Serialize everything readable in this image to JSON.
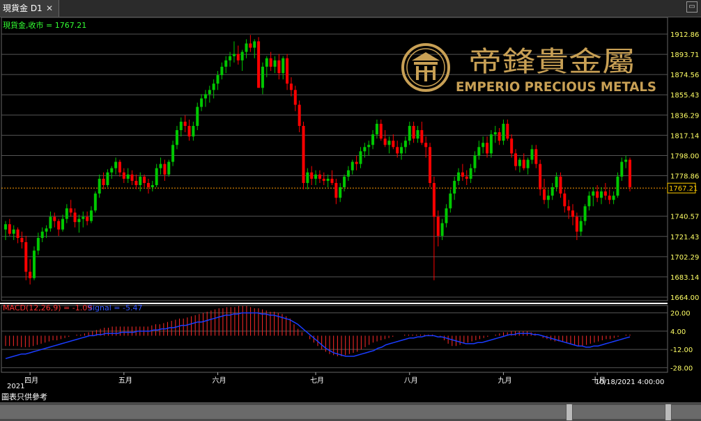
{
  "window": {
    "tab_title": "現貨金 D1",
    "close_glyph": "✕",
    "minimize_glyph": "▭"
  },
  "info": {
    "price_label": "現貨金,收市 = 1767.21",
    "macd_label": "MACD(12,26,9) = -1.09",
    "signal_label": "Signal = -5.47"
  },
  "logo": {
    "cn": "帝鋒貴金屬",
    "en": "EMPERIO PRECIOUS METALS",
    "emblem": "emperio-emblem-icon"
  },
  "current_price": "1767.21",
  "year_label": "2021",
  "datetime_label": "10/18/2021 4:00:00",
  "disclaimer": "圖表只供參考",
  "colors": {
    "up": "#00c800",
    "down": "#ff0000",
    "macd_hist": "#ff2a2a",
    "signal": "#1a3cff",
    "grid": "#555555",
    "axis_text": "#ffff66",
    "gold": "#c8a055"
  },
  "chart_data": [
    {
      "type": "candlestick",
      "title": "現貨金 D1",
      "y_ticks": [
        "1912.86",
        "1893.71",
        "1874.56",
        "1855.43",
        "1836.29",
        "1817.14",
        "1798.00",
        "1778.86",
        "1767.21",
        "1740.57",
        "1721.43",
        "1702.29",
        "1683.14",
        "1664.00"
      ],
      "ylim": [
        1664.0,
        1912.86
      ],
      "x_ticks": [
        "四月",
        "五月",
        "六月",
        "七月",
        "八月",
        "九月",
        "十月"
      ],
      "last_close": 1767.21,
      "ohlc": [
        [
          1728,
          1736,
          1718,
          1733
        ],
        [
          1733,
          1738,
          1722,
          1724
        ],
        [
          1724,
          1732,
          1718,
          1728
        ],
        [
          1728,
          1730,
          1715,
          1720
        ],
        [
          1720,
          1726,
          1710,
          1716
        ],
        [
          1716,
          1722,
          1680,
          1688
        ],
        [
          1688,
          1700,
          1676,
          1682
        ],
        [
          1682,
          1712,
          1680,
          1708
        ],
        [
          1708,
          1725,
          1704,
          1720
        ],
        [
          1720,
          1730,
          1716,
          1726
        ],
        [
          1726,
          1732,
          1720,
          1729
        ],
        [
          1729,
          1745,
          1726,
          1740
        ],
        [
          1740,
          1744,
          1730,
          1736
        ],
        [
          1736,
          1738,
          1722,
          1728
        ],
        [
          1728,
          1742,
          1726,
          1738
        ],
        [
          1738,
          1752,
          1734,
          1748
        ],
        [
          1748,
          1756,
          1740,
          1744
        ],
        [
          1744,
          1748,
          1730,
          1735
        ],
        [
          1735,
          1742,
          1725,
          1738
        ],
        [
          1738,
          1745,
          1730,
          1740
        ],
        [
          1740,
          1745,
          1732,
          1736
        ],
        [
          1736,
          1750,
          1734,
          1746
        ],
        [
          1746,
          1764,
          1744,
          1762
        ],
        [
          1762,
          1780,
          1758,
          1776
        ],
        [
          1776,
          1782,
          1766,
          1770
        ],
        [
          1770,
          1785,
          1768,
          1782
        ],
        [
          1782,
          1788,
          1776,
          1786
        ],
        [
          1786,
          1796,
          1780,
          1792
        ],
        [
          1792,
          1794,
          1778,
          1782
        ],
        [
          1782,
          1786,
          1772,
          1776
        ],
        [
          1776,
          1786,
          1772,
          1780
        ],
        [
          1780,
          1784,
          1770,
          1774
        ],
        [
          1774,
          1780,
          1766,
          1770
        ],
        [
          1770,
          1782,
          1764,
          1778
        ],
        [
          1778,
          1780,
          1768,
          1772
        ],
        [
          1772,
          1776,
          1762,
          1768
        ],
        [
          1768,
          1774,
          1764,
          1770
        ],
        [
          1770,
          1790,
          1768,
          1786
        ],
        [
          1786,
          1796,
          1780,
          1790
        ],
        [
          1790,
          1794,
          1774,
          1780
        ],
        [
          1780,
          1794,
          1778,
          1792
        ],
        [
          1792,
          1812,
          1788,
          1808
        ],
        [
          1808,
          1826,
          1804,
          1822
        ],
        [
          1822,
          1834,
          1816,
          1830
        ],
        [
          1830,
          1836,
          1820,
          1826
        ],
        [
          1826,
          1832,
          1812,
          1816
        ],
        [
          1816,
          1830,
          1812,
          1826
        ],
        [
          1826,
          1848,
          1822,
          1844
        ],
        [
          1844,
          1856,
          1840,
          1852
        ],
        [
          1852,
          1860,
          1844,
          1856
        ],
        [
          1856,
          1864,
          1848,
          1860
        ],
        [
          1860,
          1870,
          1852,
          1866
        ],
        [
          1866,
          1878,
          1860,
          1874
        ],
        [
          1874,
          1886,
          1870,
          1882
        ],
        [
          1882,
          1892,
          1876,
          1888
        ],
        [
          1888,
          1896,
          1882,
          1892
        ],
        [
          1892,
          1906,
          1886,
          1894
        ],
        [
          1894,
          1902,
          1884,
          1888
        ],
        [
          1888,
          1898,
          1878,
          1896
        ],
        [
          1896,
          1908,
          1890,
          1904
        ],
        [
          1904,
          1912,
          1896,
          1900
        ],
        [
          1900,
          1908,
          1890,
          1906
        ],
        [
          1906,
          1910,
          1880,
          1862
        ],
        [
          1862,
          1886,
          1856,
          1882
        ],
        [
          1882,
          1892,
          1872,
          1890
        ],
        [
          1890,
          1896,
          1878,
          1882
        ],
        [
          1882,
          1892,
          1876,
          1888
        ],
        [
          1888,
          1894,
          1870,
          1876
        ],
        [
          1876,
          1892,
          1870,
          1890
        ],
        [
          1890,
          1894,
          1860,
          1866
        ],
        [
          1866,
          1872,
          1854,
          1860
        ],
        [
          1860,
          1864,
          1840,
          1846
        ],
        [
          1846,
          1850,
          1820,
          1826
        ],
        [
          1826,
          1830,
          1766,
          1772
        ],
        [
          1772,
          1786,
          1766,
          1782
        ],
        [
          1782,
          1788,
          1770,
          1776
        ],
        [
          1776,
          1784,
          1770,
          1780
        ],
        [
          1780,
          1784,
          1772,
          1776
        ],
        [
          1776,
          1782,
          1770,
          1774
        ],
        [
          1774,
          1780,
          1768,
          1776
        ],
        [
          1776,
          1784,
          1770,
          1772
        ],
        [
          1772,
          1776,
          1752,
          1758
        ],
        [
          1758,
          1772,
          1754,
          1768
        ],
        [
          1768,
          1780,
          1764,
          1778
        ],
        [
          1778,
          1788,
          1774,
          1784
        ],
        [
          1784,
          1794,
          1780,
          1792
        ],
        [
          1792,
          1798,
          1784,
          1790
        ],
        [
          1790,
          1806,
          1786,
          1802
        ],
        [
          1802,
          1810,
          1796,
          1806
        ],
        [
          1806,
          1812,
          1798,
          1808
        ],
        [
          1808,
          1822,
          1804,
          1818
        ],
        [
          1818,
          1832,
          1814,
          1828
        ],
        [
          1828,
          1832,
          1812,
          1814
        ],
        [
          1814,
          1822,
          1806,
          1808
        ],
        [
          1808,
          1816,
          1800,
          1812
        ],
        [
          1812,
          1818,
          1804,
          1806
        ],
        [
          1806,
          1812,
          1796,
          1800
        ],
        [
          1800,
          1810,
          1794,
          1806
        ],
        [
          1806,
          1816,
          1800,
          1812
        ],
        [
          1812,
          1830,
          1808,
          1826
        ],
        [
          1826,
          1830,
          1810,
          1814
        ],
        [
          1814,
          1826,
          1810,
          1822
        ],
        [
          1822,
          1830,
          1808,
          1810
        ],
        [
          1810,
          1816,
          1796,
          1806
        ],
        [
          1806,
          1810,
          1768,
          1772
        ],
        [
          1772,
          1778,
          1680,
          1740
        ],
        [
          1740,
          1746,
          1712,
          1722
        ],
        [
          1722,
          1738,
          1718,
          1734
        ],
        [
          1734,
          1752,
          1730,
          1748
        ],
        [
          1748,
          1766,
          1744,
          1762
        ],
        [
          1762,
          1778,
          1756,
          1774
        ],
        [
          1774,
          1786,
          1770,
          1782
        ],
        [
          1782,
          1790,
          1774,
          1778
        ],
        [
          1778,
          1784,
          1770,
          1776
        ],
        [
          1776,
          1790,
          1772,
          1786
        ],
        [
          1786,
          1802,
          1782,
          1798
        ],
        [
          1798,
          1812,
          1794,
          1806
        ],
        [
          1806,
          1816,
          1800,
          1810
        ],
        [
          1810,
          1816,
          1796,
          1800
        ],
        [
          1800,
          1822,
          1796,
          1818
        ],
        [
          1818,
          1826,
          1810,
          1820
        ],
        [
          1820,
          1824,
          1808,
          1812
        ],
        [
          1812,
          1832,
          1808,
          1828
        ],
        [
          1828,
          1832,
          1812,
          1814
        ],
        [
          1814,
          1818,
          1796,
          1800
        ],
        [
          1800,
          1804,
          1784,
          1788
        ],
        [
          1788,
          1796,
          1782,
          1794
        ],
        [
          1794,
          1800,
          1784,
          1786
        ],
        [
          1786,
          1796,
          1780,
          1794
        ],
        [
          1794,
          1808,
          1790,
          1804
        ],
        [
          1804,
          1808,
          1786,
          1790
        ],
        [
          1790,
          1794,
          1760,
          1766
        ],
        [
          1766,
          1776,
          1752,
          1756
        ],
        [
          1756,
          1766,
          1748,
          1760
        ],
        [
          1760,
          1772,
          1756,
          1768
        ],
        [
          1768,
          1782,
          1764,
          1778
        ],
        [
          1778,
          1782,
          1758,
          1762
        ],
        [
          1762,
          1766,
          1744,
          1750
        ],
        [
          1750,
          1756,
          1738,
          1746
        ],
        [
          1746,
          1752,
          1732,
          1740
        ],
        [
          1740,
          1744,
          1718,
          1726
        ],
        [
          1726,
          1740,
          1722,
          1736
        ],
        [
          1736,
          1752,
          1732,
          1750
        ],
        [
          1750,
          1764,
          1746,
          1760
        ],
        [
          1760,
          1768,
          1750,
          1764
        ],
        [
          1764,
          1770,
          1754,
          1758
        ],
        [
          1758,
          1768,
          1752,
          1764
        ],
        [
          1764,
          1772,
          1756,
          1760
        ],
        [
          1760,
          1766,
          1752,
          1756
        ],
        [
          1756,
          1764,
          1752,
          1760
        ],
        [
          1760,
          1782,
          1758,
          1778
        ],
        [
          1778,
          1796,
          1774,
          1792
        ],
        [
          1792,
          1798,
          1786,
          1794
        ],
        [
          1794,
          1796,
          1764,
          1768
        ]
      ]
    },
    {
      "type": "macd",
      "title": "MACD(12,26,9)",
      "y_ticks": [
        "20.00",
        "4.00",
        "-12.00",
        "-28.00"
      ],
      "ylim": [
        -32,
        24
      ],
      "histogram": [
        -9,
        -9,
        -9,
        -9,
        -10,
        -10,
        -10,
        -9,
        -8,
        -7,
        -6,
        -5,
        -4,
        -4,
        -3,
        -2,
        -1,
        0,
        1,
        1,
        2,
        3,
        4,
        5,
        6,
        7,
        7,
        8,
        8,
        8,
        8,
        8,
        8,
        8,
        8,
        8,
        8,
        9,
        10,
        10,
        11,
        12,
        13,
        14,
        15,
        15,
        16,
        17,
        18,
        19,
        20,
        21,
        22,
        23,
        24,
        24,
        25,
        25,
        25,
        26,
        26,
        26,
        25,
        24,
        24,
        23,
        22,
        21,
        21,
        20,
        19,
        17,
        15,
        10,
        6,
        3,
        0,
        -3,
        -6,
        -9,
        -12,
        -14,
        -16,
        -17,
        -18,
        -18,
        -17,
        -16,
        -15,
        -14,
        -12,
        -10,
        -8,
        -6,
        -5,
        -4,
        -3,
        -2,
        -1,
        0,
        0,
        1,
        1,
        1,
        1,
        1,
        1,
        1,
        1,
        0,
        -1,
        -4,
        -7,
        -9,
        -9,
        -8,
        -7,
        -6,
        -5,
        -4,
        -3,
        -2,
        -1,
        0,
        1,
        2,
        3,
        3,
        4,
        4,
        4,
        4,
        4,
        3,
        2,
        0,
        -2,
        -3,
        -4,
        -5,
        -5,
        -5,
        -6,
        -7,
        -8,
        -9,
        -9,
        -8,
        -7,
        -6,
        -5,
        -4,
        -3,
        -3,
        -2,
        -1,
        0,
        1,
        1
      ],
      "signal": [
        -20,
        -19,
        -18,
        -17,
        -16,
        -16,
        -15,
        -14,
        -13,
        -12,
        -11,
        -10,
        -9,
        -8,
        -7,
        -6,
        -5,
        -4,
        -3,
        -2,
        -1,
        0,
        0,
        1,
        1,
        2,
        2,
        2,
        2,
        3,
        3,
        3,
        3,
        4,
        4,
        4,
        4,
        5,
        5,
        6,
        6,
        7,
        7,
        8,
        9,
        9,
        10,
        11,
        12,
        12,
        13,
        14,
        15,
        16,
        17,
        18,
        18,
        19,
        19,
        20,
        20,
        20,
        20,
        20,
        19,
        19,
        18,
        18,
        17,
        16,
        15,
        14,
        12,
        10,
        7,
        4,
        1,
        -2,
        -5,
        -8,
        -11,
        -13,
        -15,
        -16,
        -17,
        -18,
        -18,
        -18,
        -17,
        -16,
        -15,
        -14,
        -13,
        -11,
        -10,
        -8,
        -7,
        -6,
        -5,
        -4,
        -3,
        -2,
        -2,
        -1,
        -1,
        0,
        0,
        0,
        -1,
        -1,
        -2,
        -3,
        -4,
        -5,
        -6,
        -7,
        -7,
        -7,
        -6,
        -6,
        -5,
        -4,
        -3,
        -2,
        -1,
        0,
        1,
        1,
        2,
        2,
        2,
        2,
        1,
        1,
        0,
        -1,
        -2,
        -3,
        -4,
        -5,
        -6,
        -7,
        -8,
        -9,
        -9,
        -10,
        -10,
        -9,
        -9,
        -8,
        -7,
        -6,
        -5,
        -4,
        -3,
        -2,
        -1
      ]
    }
  ]
}
